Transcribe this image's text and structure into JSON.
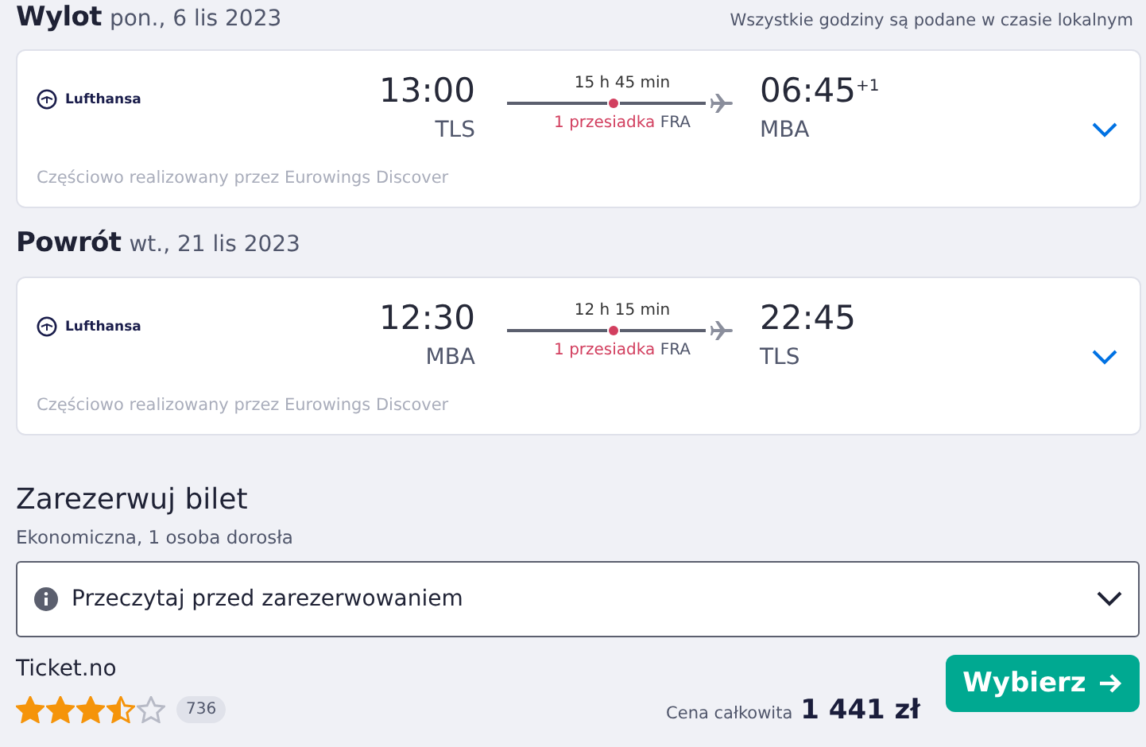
{
  "timezone_note": "Wszystkie godziny są podane w czasie lokalnym",
  "legs": [
    {
      "title": "Wylot",
      "date": "pon., 6 lis 2023",
      "airline": "Lufthansa",
      "depart_time": "13:00",
      "depart_airport": "TLS",
      "duration": "15 h 45 min",
      "stops": "1 przesiadka",
      "via": "FRA",
      "arrive_time": "06:45",
      "day_offset": "+1",
      "arrive_airport": "MBA",
      "operated_by": "Częściowo realizowany przez Eurowings Discover",
      "expanded": false
    },
    {
      "title": "Powrót",
      "date": "wt., 21 lis 2023",
      "airline": "Lufthansa",
      "depart_time": "12:30",
      "depart_airport": "MBA",
      "duration": "12 h 15 min",
      "stops": "1 przesiadka",
      "via": "FRA",
      "arrive_time": "22:45",
      "arrive_airport": "TLS",
      "operated_by": "Częściowo realizowany przez Eurowings Discover",
      "expanded": false
    }
  ],
  "booking": {
    "title": "Zarezerwuj bilet",
    "subtitle": "Ekonomiczna, 1 osoba dorosła",
    "info_dropdown": {
      "label": "Przeczytaj przed zarezerwowaniem",
      "expanded": false
    },
    "provider": "Ticket.no",
    "stars": 3.5,
    "review_count": "736",
    "price_label": "Cena całkowita",
    "price": "1 441 zł",
    "select_button": "Wybierz"
  }
}
